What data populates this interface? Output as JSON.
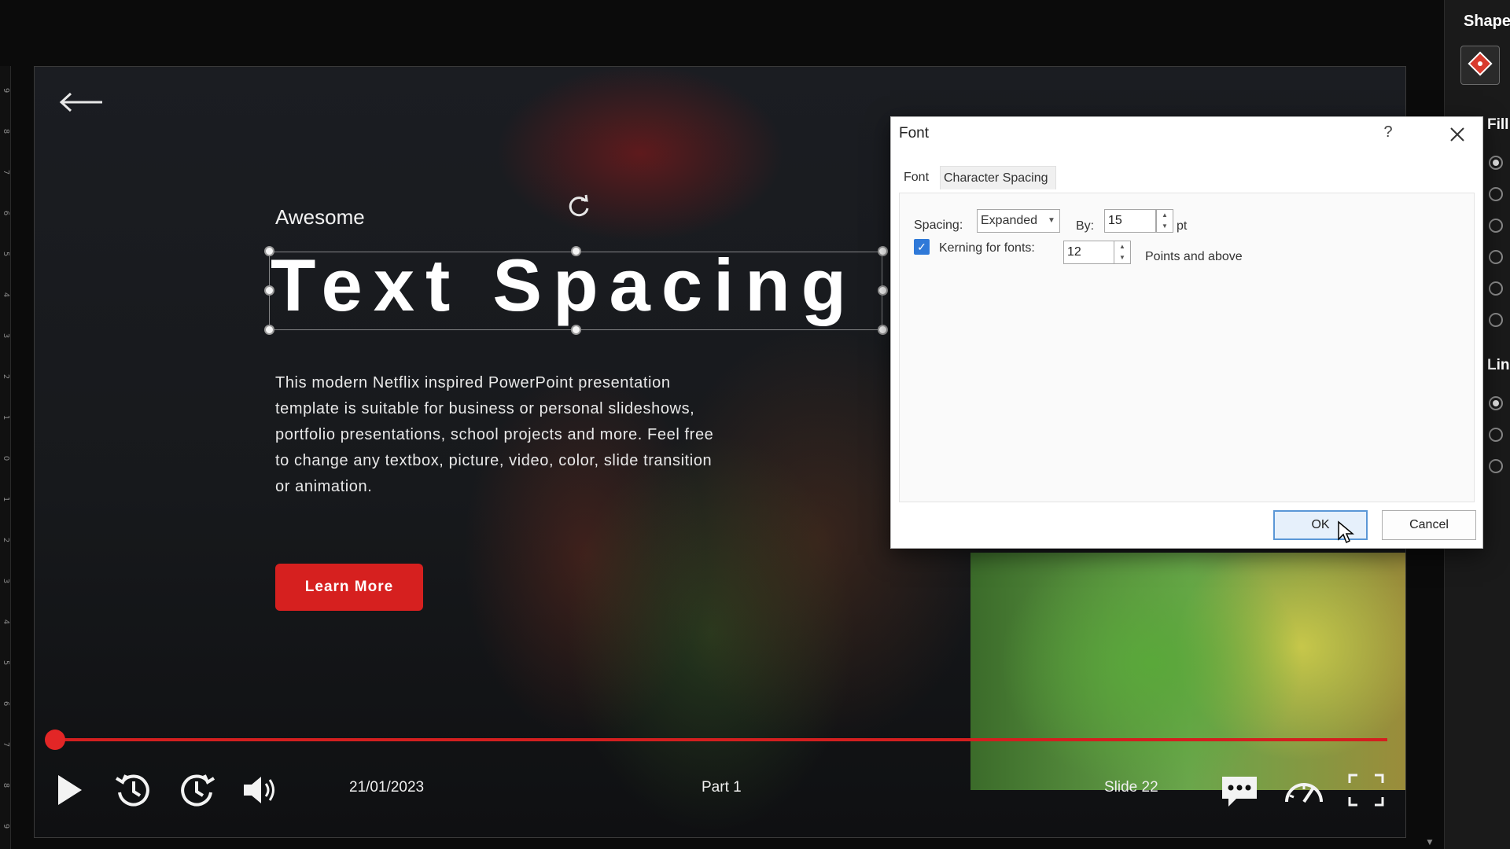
{
  "slide": {
    "subtitle": "Awesome",
    "title": "Text Spacing",
    "body": "This modern Netflix inspired PowerPoint presentation template is suitable for business or personal slideshows, portfolio presentations, school projects and more. Feel free to change any textbox, picture, video, color, slide transition or animation.",
    "button_label": "Learn More",
    "player": {
      "date": "21/01/2023",
      "part": "Part 1",
      "slide_label": "Slide 22",
      "progress_fraction": 0.0
    }
  },
  "ruler": [
    "9",
    "8",
    "7",
    "6",
    "5",
    "4",
    "3",
    "2",
    "1",
    "0",
    "1",
    "2",
    "3",
    "4",
    "5",
    "6",
    "7",
    "8",
    "9"
  ],
  "right_pane": {
    "title": "Shape",
    "fill_label": "Fill",
    "line_label": "Line"
  },
  "dialog": {
    "title": "Font",
    "help": "?",
    "tabs": [
      "Font",
      "Character Spacing"
    ],
    "spacing_label": "Spacing:",
    "spacing_value": "Expanded",
    "by_label": "By:",
    "by_value": "15",
    "pt_label": "pt",
    "kerning_checked": true,
    "kerning_label": "Kerning for fonts:",
    "kerning_value": "12",
    "points_label": "Points and above",
    "ok_label": "OK",
    "cancel_label": "Cancel"
  },
  "colors": {
    "accent_red": "#d6201f",
    "checkbox_blue": "#2f79d8"
  }
}
